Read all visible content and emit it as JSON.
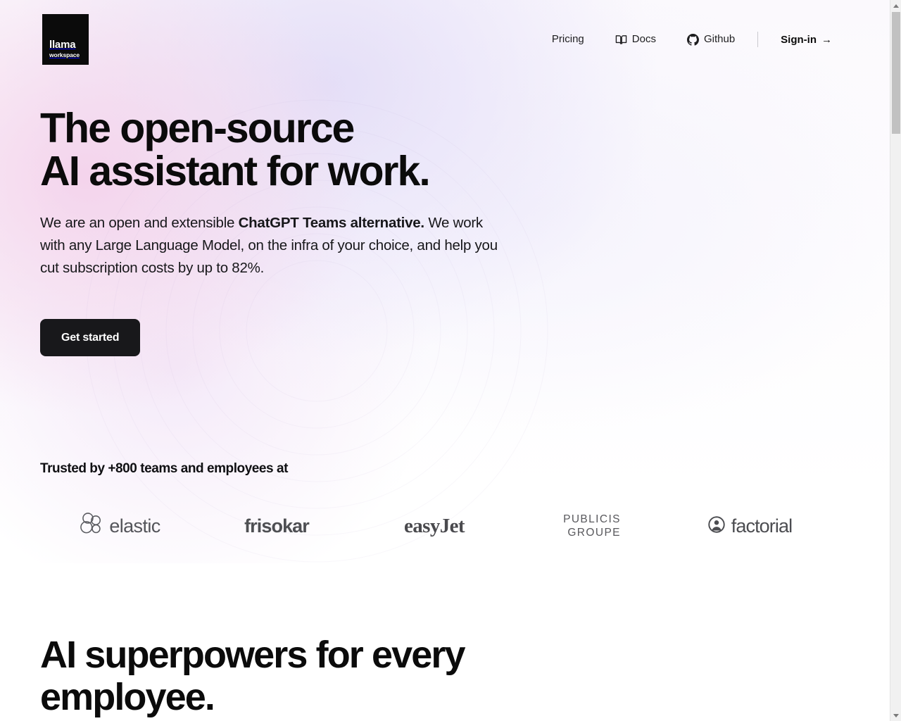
{
  "brand": {
    "logo_main": "llama",
    "logo_sub": "workspace",
    "logo_bg": "#0b0b0b"
  },
  "nav": {
    "items": [
      {
        "label": "Pricing",
        "icon": ""
      },
      {
        "label": "Docs",
        "icon": "book-icon"
      },
      {
        "label": "Github",
        "icon": "github-icon"
      }
    ],
    "signin": {
      "label": "Sign-in",
      "arrow": "→"
    }
  },
  "hero": {
    "title_line1": "The open-source",
    "title_line2": "AI assistant for work.",
    "subtitle_part1": "We are an open and extensible ",
    "subtitle_bold": "ChatGPT Teams alternative.",
    "subtitle_part2": " We work with any Large Language Model, on the infra of your choice, and help you cut subscription costs by up to 82%.",
    "cta_label": "Get started"
  },
  "trusted": {
    "title": "Trusted by +800 teams and employees at",
    "logos": [
      {
        "name": "elastic",
        "text": "elastic"
      },
      {
        "name": "frisokar",
        "text": "frisokar"
      },
      {
        "name": "easyjet",
        "text": "easyJet"
      },
      {
        "name": "publicis-groupe",
        "text_line1": "PUBLICIS",
        "text_line2": "GROUPE"
      },
      {
        "name": "factorial",
        "text": "factorial"
      }
    ]
  },
  "section_two": {
    "title_line1": "AI superpowers for every",
    "title_line2": "employee."
  },
  "colors": {
    "accent_dark": "#18181b",
    "text_primary": "#0b0b0b",
    "gradient_pink": "#f3cee9",
    "gradient_lavender": "#dfd8f6",
    "logo_gray": "#54555a"
  },
  "scrollbar": {
    "up_arrow": "▲",
    "down_arrow": "▼"
  }
}
